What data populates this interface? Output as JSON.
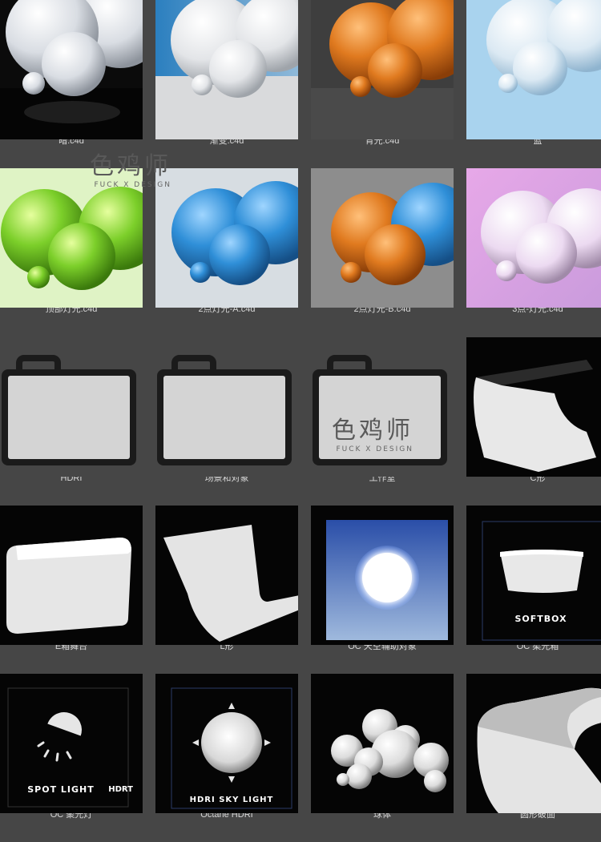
{
  "items": [
    {
      "label": "暗.c4d",
      "icon": "spheres-dark-render"
    },
    {
      "label": "渐变.c4d",
      "icon": "spheres-gradient-render"
    },
    {
      "label": "背光.c4d",
      "icon": "spheres-backlight-render"
    },
    {
      "label": "蓝",
      "icon": "spheres-blue-render"
    },
    {
      "label": "顶部灯光.c4d",
      "icon": "spheres-green-render"
    },
    {
      "label": "2点灯光-A.c4d",
      "icon": "spheres-blue-two-point-render"
    },
    {
      "label": "2点灯光-B.c4d",
      "icon": "spheres-orange-two-point-render"
    },
    {
      "label": "3点-灯光.c4d",
      "icon": "spheres-pink-render"
    },
    {
      "label": "HDRI",
      "icon": "folder-icon"
    },
    {
      "label": "场景和对象",
      "icon": "folder-icon"
    },
    {
      "label": "工作室",
      "icon": "folder-icon"
    },
    {
      "label": "C形",
      "icon": "c-shape-backdrop"
    },
    {
      "label": "E箱舞台",
      "icon": "box-stage"
    },
    {
      "label": "L形",
      "icon": "l-shape-backdrop"
    },
    {
      "label": "OC 天空辅助对象",
      "icon": "sky-helper"
    },
    {
      "label": "OC 柔光箱",
      "icon": "softbox"
    },
    {
      "label": "OC 聚光灯",
      "icon": "spot-light"
    },
    {
      "label": "Octane HDRI",
      "icon": "hdri-sky-light"
    },
    {
      "label": "球体",
      "icon": "spheres-cluster"
    },
    {
      "label": "圆形破面",
      "icon": "round-backdrop"
    }
  ],
  "thumb_text": {
    "softbox": "SOFTBOX",
    "spot_light": "SPOT LIGHT",
    "hdrt": "HDRT",
    "hdri_sky_light": "HDRI SKY LIGHT"
  },
  "watermark": {
    "cn": "色鸡师",
    "en": "FUCK X DESIGN"
  },
  "colors": {
    "background": "#464646",
    "label_text": "#d8d8d8",
    "orange": "#e07a1f",
    "blue": "#2f8fd8",
    "green": "#7ccf2a"
  }
}
